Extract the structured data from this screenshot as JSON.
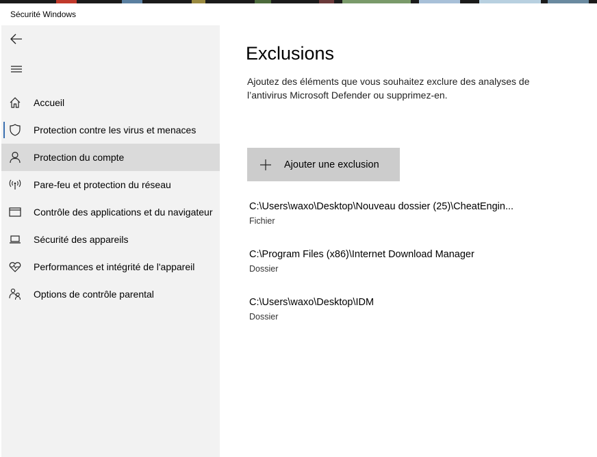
{
  "window": {
    "title": "Sécurité Windows"
  },
  "sidebar": {
    "back_icon": "back-arrow-icon",
    "menu_icon": "hamburger-menu-icon",
    "items": [
      {
        "label": "Accueil",
        "icon": "home-icon"
      },
      {
        "label": "Protection contre les virus et menaces",
        "icon": "shield-icon"
      },
      {
        "label": "Protection du compte",
        "icon": "person-icon"
      },
      {
        "label": "Pare-feu et protection du réseau",
        "icon": "antenna-icon"
      },
      {
        "label": "Contrôle des applications et du navigateur",
        "icon": "browser-window-icon"
      },
      {
        "label": "Sécurité des appareils",
        "icon": "laptop-icon"
      },
      {
        "label": "Performances et intégrité de l'appareil",
        "icon": "heart-pulse-icon"
      },
      {
        "label": "Options de contrôle parental",
        "icon": "family-icon"
      }
    ]
  },
  "main": {
    "title": "Exclusions",
    "description": "Ajoutez des éléments que vous souhaitez exclure des analyses de l’antivirus Microsoft Defender ou supprimez-en.",
    "add_button_label": "Ajouter une exclusion",
    "exclusions": [
      {
        "path": "C:\\Users\\waxo\\Desktop\\Nouveau dossier (25)\\CheatEngin...",
        "type": "Fichier"
      },
      {
        "path": "C:\\Program Files (x86)\\Internet Download Manager",
        "type": "Dossier"
      },
      {
        "path": "C:\\Users\\waxo\\Desktop\\IDM",
        "type": "Dossier"
      }
    ]
  },
  "colors": {
    "sidebar_bg": "#f2f2f2",
    "selected_bg": "#dadada",
    "accent": "#3a6fb0",
    "button_bg": "#cccccc"
  }
}
